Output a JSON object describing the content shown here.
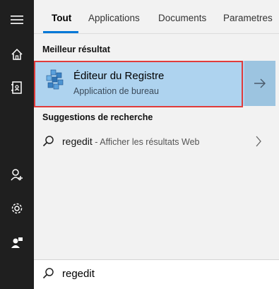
{
  "tabs": [
    {
      "label": "Tout",
      "active": true
    },
    {
      "label": "Applications",
      "active": false
    },
    {
      "label": "Documents",
      "active": false
    },
    {
      "label": "Parametres",
      "active": false
    }
  ],
  "best_match": {
    "heading": "Meilleur résultat",
    "title": "Éditeur du Registre",
    "subtitle": "Application de bureau",
    "icon": "registry-editor-icon"
  },
  "suggestions": {
    "heading": "Suggestions de recherche",
    "items": [
      {
        "term": "regedit",
        "hint": " - Afficher les résultats Web"
      }
    ]
  },
  "search": {
    "value": "regedit"
  },
  "sidebar": {
    "items": [
      "hamburger-menu-icon",
      "home-icon",
      "notebook-icon",
      "account-icon",
      "settings-icon",
      "feedback-icon"
    ]
  },
  "colors": {
    "sidebar_bg": "#1f1f1f",
    "panel_bg": "#f2f2f2",
    "selected_bg": "#aed3ef",
    "highlight_border": "#e03b3b",
    "accent": "#0078d7"
  }
}
